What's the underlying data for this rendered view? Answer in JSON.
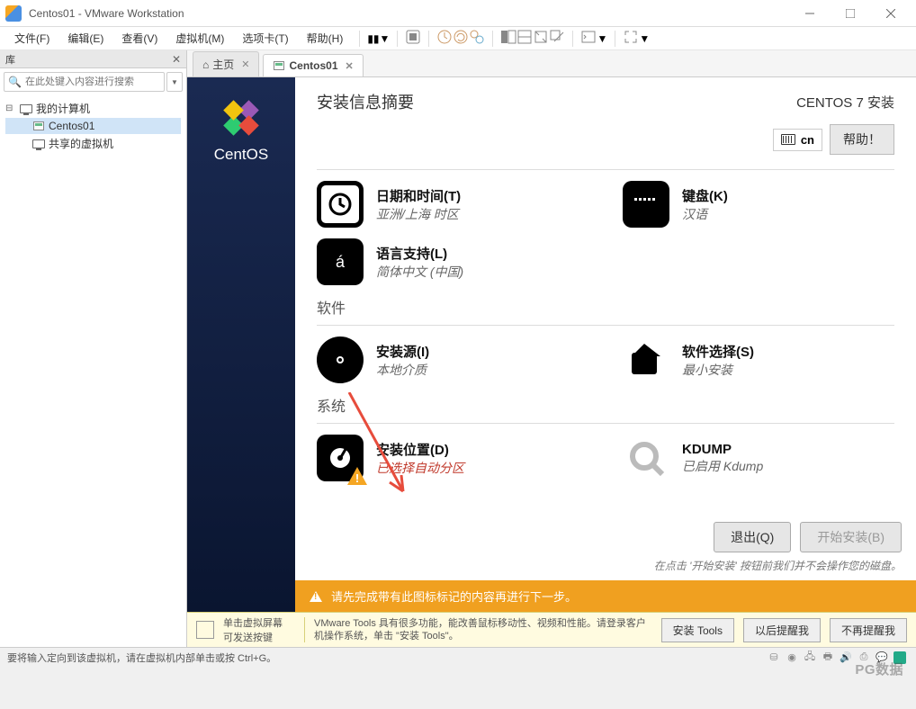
{
  "titlebar": {
    "title": "Centos01 - VMware Workstation"
  },
  "menus": [
    "文件(F)",
    "编辑(E)",
    "查看(V)",
    "虚拟机(M)",
    "选项卡(T)",
    "帮助(H)"
  ],
  "library": {
    "header": "库",
    "search_placeholder": "在此处键入内容进行搜索",
    "nodes": {
      "root": "我的计算机",
      "vm": "Centos01",
      "shared": "共享的虚拟机"
    }
  },
  "tabs": {
    "home": "主页",
    "vm": "Centos01"
  },
  "installer": {
    "summary_title": "安装信息摘要",
    "header_right": "CENTOS 7 安装",
    "lang_code": "cn",
    "help": "帮助！",
    "sections": {
      "software": "软件",
      "system": "系统"
    },
    "items": {
      "datetime": {
        "label": "日期和时间(T)",
        "sub": "亚洲/上海 时区"
      },
      "keyboard": {
        "label": "键盘(K)",
        "sub": "汉语"
      },
      "lang": {
        "label": "语言支持(L)",
        "sub": "简体中文 (中国)"
      },
      "source": {
        "label": "安装源(I)",
        "sub": "本地介质"
      },
      "softsel": {
        "label": "软件选择(S)",
        "sub": "最小安装"
      },
      "dest": {
        "label": "安装位置(D)",
        "sub": "已选择自动分区"
      },
      "kdump": {
        "label": "KDUMP",
        "sub": "已启用 Kdump"
      }
    },
    "buttons": {
      "quit": "退出(Q)",
      "begin": "开始安装(B)"
    },
    "hint": "在点击 '开始安装' 按钮前我们并不会操作您的磁盘。",
    "warn": "请先完成带有此图标标记的内容再进行下一步。"
  },
  "tools": {
    "text": "单击虚拟屏幕\n可发送按键",
    "desc": "VMware Tools 具有很多功能，能改善鼠标移动性、视频和性能。请登录客户机操作系统，单击 \"安装 Tools\"。",
    "install": "安装 Tools",
    "later": "以后提醒我",
    "never": "不再提醒我"
  },
  "status": {
    "msg": "要将输入定向到该虚拟机，请在虚拟机内部单击或按 Ctrl+G。"
  },
  "watermark": "PG数据"
}
